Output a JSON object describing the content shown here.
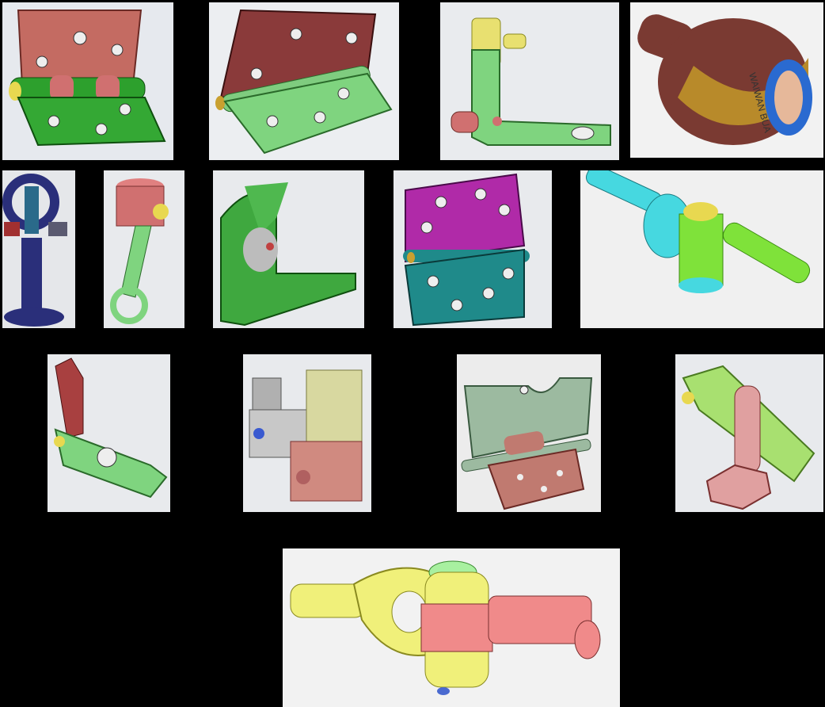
{
  "gallery": {
    "tiles": [
      {
        "id": "hinge-1",
        "icon": "hinge-icon",
        "description": ""
      },
      {
        "id": "hinge-2",
        "icon": "hinge-icon"
      },
      {
        "id": "bent-bracket",
        "icon": "bracket-icon"
      },
      {
        "id": "cylinder-nozzle",
        "icon": "cylinder-icon",
        "engraved_text": "WAIWAN BUA"
      },
      {
        "id": "clamp-stand",
        "icon": "clamp-icon"
      },
      {
        "id": "piston-rod",
        "icon": "piston-icon"
      },
      {
        "id": "wheel-bracket",
        "icon": "wheel-bracket-icon"
      },
      {
        "id": "door-hinge",
        "icon": "hinge-icon"
      },
      {
        "id": "universal-joint-blue",
        "icon": "joint-icon"
      },
      {
        "id": "lever-block",
        "icon": "lever-icon"
      },
      {
        "id": "solenoid-valve",
        "icon": "valve-icon"
      },
      {
        "id": "flat-hinge",
        "icon": "hinge-icon"
      },
      {
        "id": "fork-bolt",
        "icon": "fork-icon"
      },
      {
        "id": "universal-joint-yellow",
        "icon": "joint-icon"
      }
    ]
  },
  "colors": {
    "background": "#000000",
    "green": "#3fa83f",
    "salmon": "#d98080",
    "yellow": "#e8e070",
    "magenta": "#b02aa8",
    "teal": "#1f8a8a",
    "navy": "#2a2f7a",
    "cyan": "#46d8e0",
    "lime": "#7fe23a",
    "brown": "#7a3a32",
    "gold": "#b88a2a",
    "grey": "#b0b0b0"
  }
}
